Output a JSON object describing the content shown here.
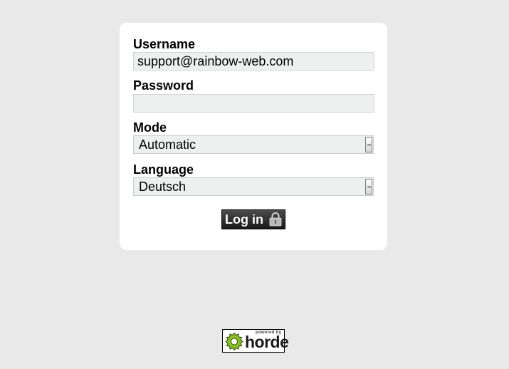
{
  "form": {
    "username": {
      "label": "Username",
      "value": "support@rainbow-web.com"
    },
    "password": {
      "label": "Password",
      "value": ""
    },
    "mode": {
      "label": "Mode",
      "selected": "Automatic"
    },
    "language": {
      "label": "Language",
      "selected": "Deutsch"
    },
    "login_button": {
      "label": "Log in",
      "icon": "lock-icon"
    }
  },
  "footer": {
    "logo_icon": "horde-gear-icon",
    "powered_by": "powered by",
    "brand": "horde"
  },
  "colors": {
    "background": "#e9e9e9",
    "card": "#ffffff",
    "input_background": "#eef0f0",
    "button": "#2a2a2a",
    "gear_green": "#8bbf2a"
  }
}
